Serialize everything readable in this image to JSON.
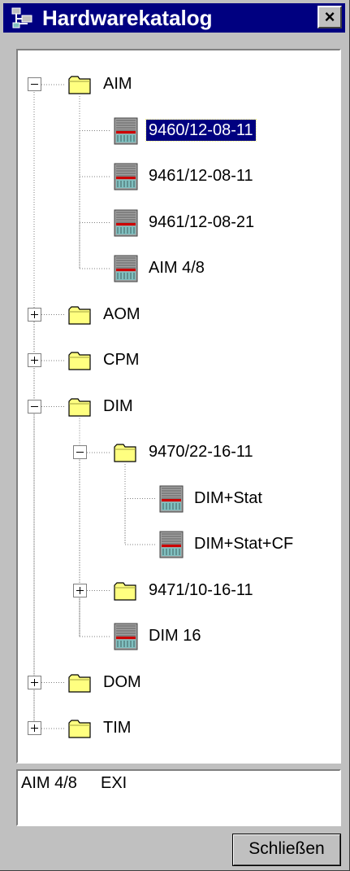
{
  "window": {
    "title": "Hardwarekatalog",
    "close_glyph": "×",
    "app_icon": "network-catalog-icon"
  },
  "tree": {
    "nodes": [
      {
        "label": "AIM",
        "kind": "folder",
        "level": 0,
        "expander": "minus"
      },
      {
        "label": "9460/12-08-11",
        "kind": "module",
        "level": 1,
        "selected": true
      },
      {
        "label": "9461/12-08-11",
        "kind": "module",
        "level": 1
      },
      {
        "label": "9461/12-08-21",
        "kind": "module",
        "level": 1
      },
      {
        "label": "AIM  4/8",
        "kind": "module",
        "level": 1
      },
      {
        "label": "AOM",
        "kind": "folder",
        "level": 0,
        "expander": "plus"
      },
      {
        "label": "CPM",
        "kind": "folder",
        "level": 0,
        "expander": "plus"
      },
      {
        "label": "DIM",
        "kind": "folder",
        "level": 0,
        "expander": "minus"
      },
      {
        "label": "9470/22-16-11",
        "kind": "folder",
        "level": 1,
        "expander": "minus"
      },
      {
        "label": "DIM+Stat",
        "kind": "module",
        "level": 2
      },
      {
        "label": "DIM+Stat+CF",
        "kind": "module",
        "level": 2
      },
      {
        "label": "9471/10-16-11",
        "kind": "folder",
        "level": 1,
        "expander": "plus"
      },
      {
        "label": "DIM 16",
        "kind": "module",
        "level": 1
      },
      {
        "label": "DOM",
        "kind": "folder",
        "level": 0,
        "expander": "plus"
      },
      {
        "label": "TIM",
        "kind": "folder",
        "level": 0,
        "expander": "plus"
      }
    ]
  },
  "status": {
    "name": "AIM 4/8",
    "type": "EXI"
  },
  "buttons": {
    "close": "Schließen"
  },
  "colors": {
    "selection": "#000080",
    "folder": "#ffff80",
    "module_red": "#cc0000",
    "module_teal": "#80c0c0"
  }
}
